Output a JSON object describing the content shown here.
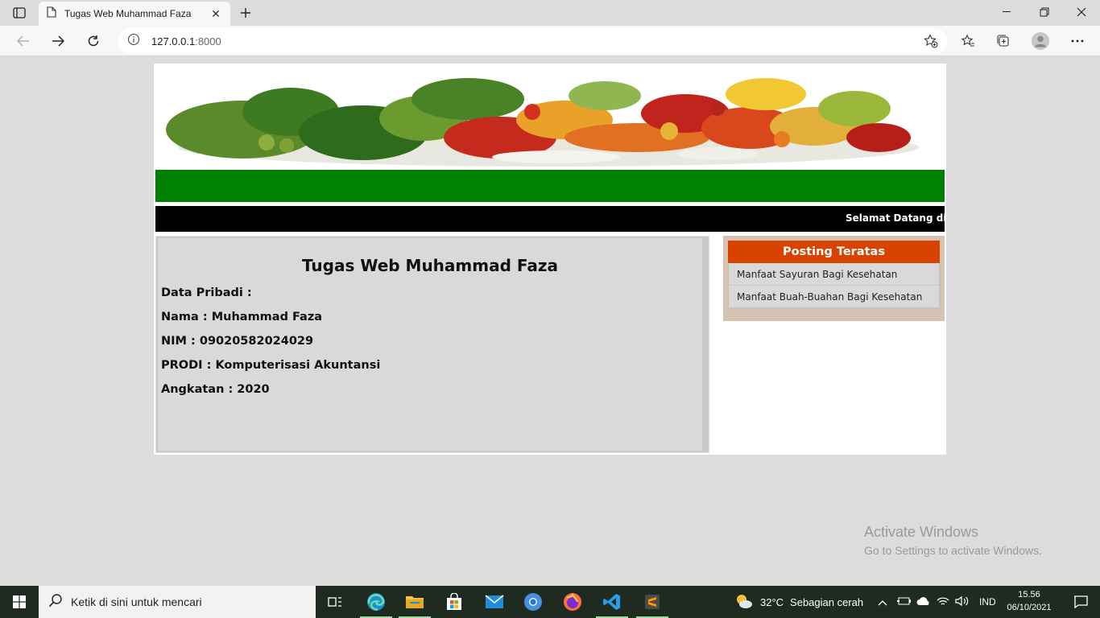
{
  "browser": {
    "tab_title": "Tugas Web Muhammad Faza",
    "tab_close": "✕",
    "url_host": "127.0.0.1",
    "url_port": ":8000"
  },
  "page": {
    "marquee": "Selamat Datang di W",
    "main_title": "Tugas Web Muhammad Faza",
    "info": [
      "Data Pribadi :",
      "Nama : Muhammad Faza",
      "NIM : 09020582024029",
      "PRODI : Komputerisasi Akuntansi",
      "Angkatan : 2020"
    ],
    "sidebar": {
      "heading": "Posting Teratas",
      "items": [
        "Manfaat Sayuran Bagi Kesehatan",
        "Manfaat Buah-Buahan Bagi Kesehatan"
      ]
    },
    "colors": {
      "green_bar": "#008000",
      "sidebar_head": "#d84302",
      "sidebar_bg": "#d6c2b0"
    }
  },
  "watermark": {
    "line1": "Activate Windows",
    "line2": "Go to Settings to activate Windows."
  },
  "taskbar": {
    "search_placeholder": "Ketik di sini untuk mencari",
    "weather_temp": "32°C",
    "weather_desc": "Sebagian cerah",
    "language": "IND",
    "time": "15.56",
    "date": "06/10/2021",
    "apps": [
      "task-view-icon",
      "edge-icon",
      "file-explorer-icon",
      "store-icon",
      "mail-icon",
      "chrome-icon",
      "firefox-icon",
      "vscode-icon",
      "sublime-icon"
    ]
  }
}
